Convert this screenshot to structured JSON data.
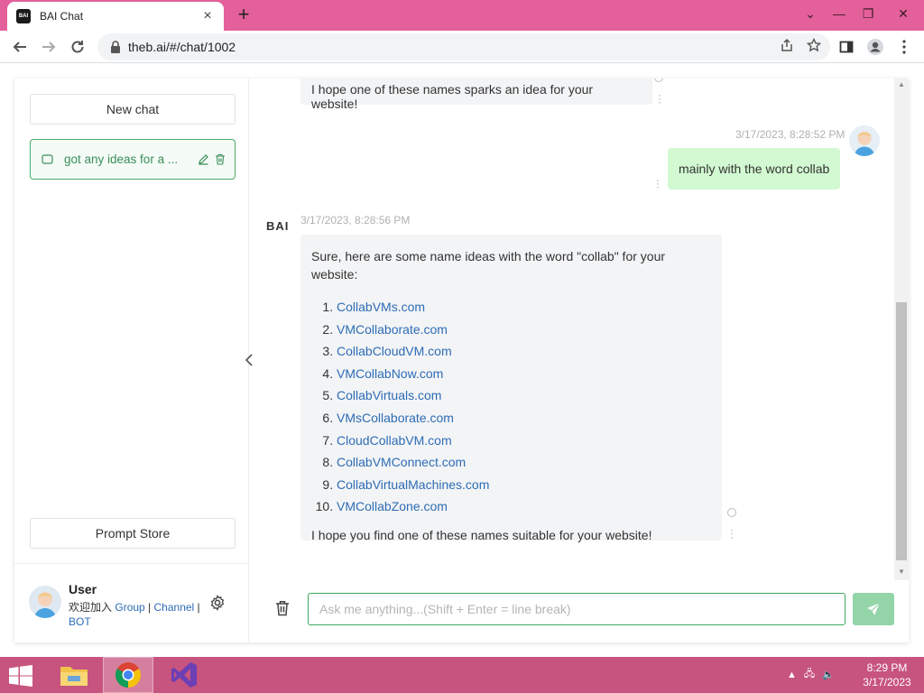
{
  "browser": {
    "tab_title": "BAI Chat",
    "tab_favicon_text": "BAI",
    "url": "theb.ai/#/chat/1002",
    "accent_color": "#e4609a"
  },
  "sidebar": {
    "new_chat_label": "New chat",
    "chats": [
      {
        "title": "got any ideas for a ..."
      }
    ],
    "prompt_store_label": "Prompt Store",
    "user": {
      "name": "User",
      "join_text": "欢迎加入",
      "links": [
        "Group",
        "Channel",
        "BOT"
      ]
    }
  },
  "messages": {
    "previous_bot_tail": "I hope one of these names sparks an idea for your website!",
    "user_message": {
      "time": "3/17/2023, 8:28:52 PM",
      "text": "mainly with the word collab"
    },
    "bot_message": {
      "sender_label": "BAI",
      "time": "3/17/2023, 8:28:56 PM",
      "intro": "Sure, here are some name ideas with the word \"collab\" for your website:",
      "items": [
        "CollabVMs.com",
        "VMCollaborate.com",
        "CollabCloudVM.com",
        "VMCollabNow.com",
        "CollabVirtuals.com",
        "VMsCollaborate.com",
        "CloudCollabVM.com",
        "CollabVMConnect.com",
        "CollabVirtualMachines.com",
        "VMCollabZone.com"
      ],
      "outro": "I hope you find one of these names suitable for your website!"
    }
  },
  "input": {
    "placeholder": "Ask me anything...(Shift + Enter = line break)",
    "value": ""
  },
  "colors": {
    "green_accent": "#3da863",
    "link_blue": "#2d6cb5",
    "user_bubble": "#d2f9d1",
    "bot_bubble": "#f3f4f6"
  },
  "taskbar": {
    "apps": [
      "file-explorer",
      "chrome",
      "visual-studio"
    ],
    "time": "8:29 PM",
    "date": "3/17/2023"
  }
}
